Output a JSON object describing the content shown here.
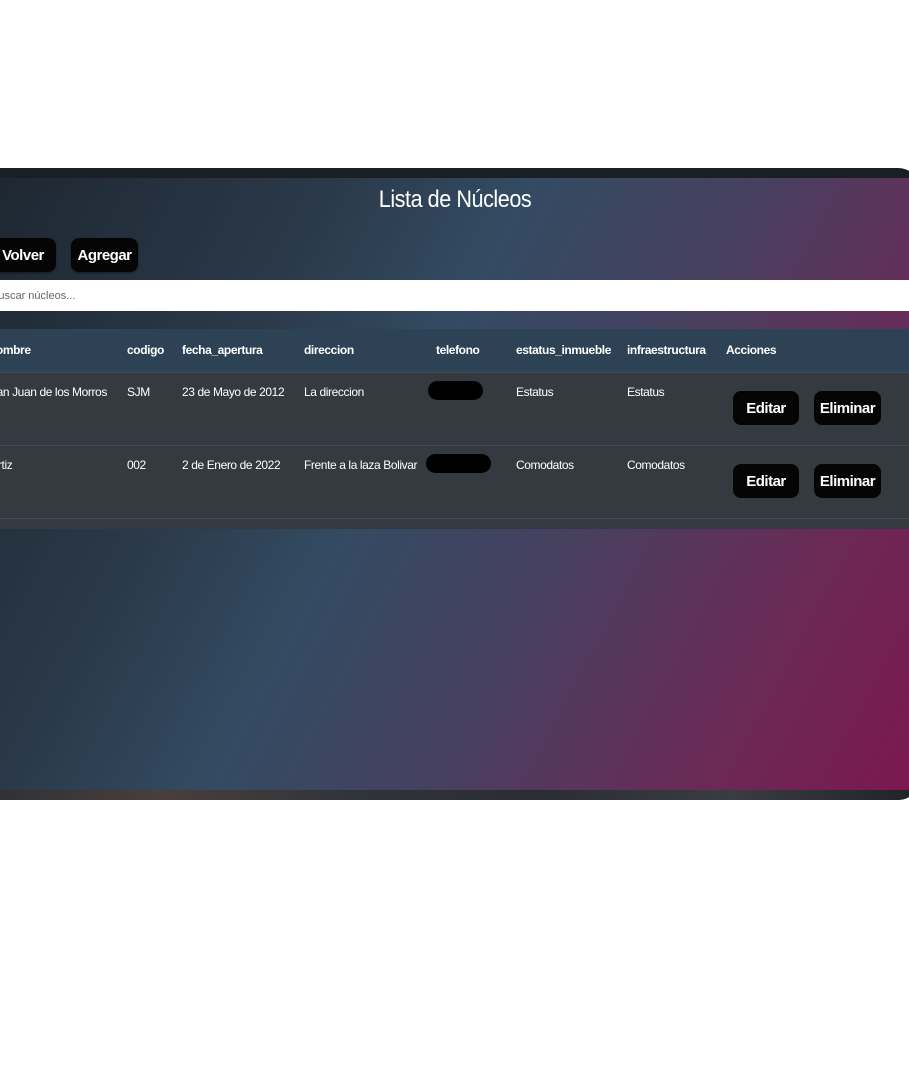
{
  "page": {
    "title": "Lista de Núcleos"
  },
  "toolbar": {
    "back_label": "Volver",
    "add_label": "Agregar"
  },
  "search": {
    "placeholder": "Buscar núcleos..."
  },
  "table": {
    "columns": [
      "nombre",
      "codigo",
      "fecha_apertura",
      "direccion",
      "telefono",
      "estatus_inmueble",
      "infraestructura",
      "Acciones"
    ],
    "rows": [
      {
        "nombre": "San Juan de los Morros",
        "codigo": "SJM",
        "fecha_apertura": "23 de Mayo de 2012",
        "direccion": "La direccion",
        "telefono": "",
        "estatus_inmueble": "Estatus",
        "infraestructura": "Estatus"
      },
      {
        "nombre": "Ortiz",
        "codigo": "002",
        "fecha_apertura": "2 de Enero de 2022",
        "direccion": "Frente a la laza Bolivar",
        "telefono": "",
        "estatus_inmueble": "Comodatos",
        "infraestructura": "Comodatos"
      }
    ],
    "actions": {
      "edit_label": "Editar",
      "delete_label": "Eliminar"
    }
  }
}
